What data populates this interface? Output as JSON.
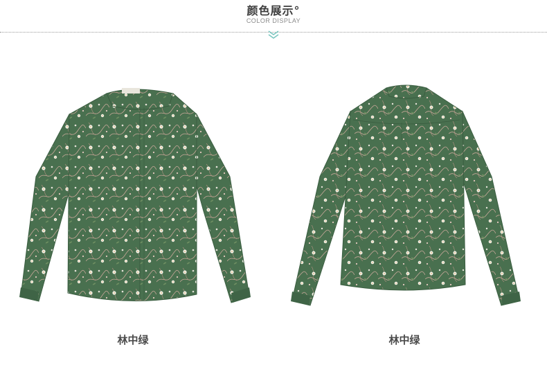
{
  "header": {
    "title": "颜色展示°",
    "subtitle": "COLOR DISPLAY"
  },
  "colors": {
    "fabric": "#49704f",
    "fabric_dark": "#3a5d40",
    "flower": "#f3f1ea",
    "vine": "#c9a89a",
    "accent": "#7cc7c0"
  },
  "products": [
    {
      "view": "front",
      "caption": "林中绿"
    },
    {
      "view": "back",
      "caption": "林中绿"
    }
  ]
}
